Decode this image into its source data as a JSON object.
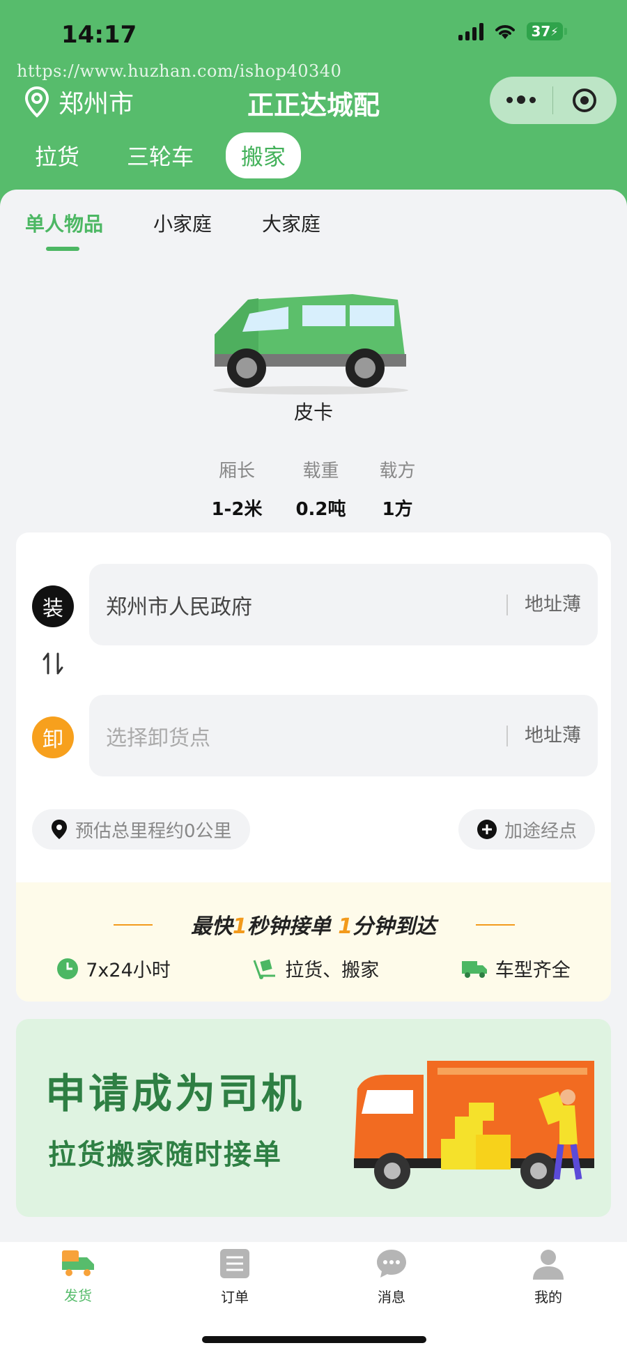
{
  "status": {
    "time": "14:17",
    "battery": "37"
  },
  "watermark": "https://www.huzhan.com/ishop40340",
  "header": {
    "city": "郑州市",
    "title": "正正达城配"
  },
  "top_tabs": [
    {
      "label": "拉货",
      "active": false
    },
    {
      "label": "三轮车",
      "active": false
    },
    {
      "label": "搬家",
      "active": true
    }
  ],
  "sub_tabs": [
    {
      "label": "单人物品",
      "active": true
    },
    {
      "label": "小家庭",
      "active": false
    },
    {
      "label": "大家庭",
      "active": false
    }
  ],
  "vehicle": {
    "name": "皮卡",
    "specs": [
      {
        "label": "厢长",
        "value": "1-2米"
      },
      {
        "label": "载重",
        "value": "0.2吨"
      },
      {
        "label": "载方",
        "value": "1方"
      }
    ]
  },
  "route": {
    "load": {
      "badge": "装",
      "value": "郑州市人民政府",
      "book": "地址薄",
      "color": "#111111"
    },
    "unload": {
      "badge": "卸",
      "placeholder": "选择卸货点",
      "book": "地址薄",
      "color": "#f7a01d"
    },
    "distance": "预估总里程约0公里",
    "add_stop": "加途经点"
  },
  "promo": {
    "title_parts": [
      "最快",
      "1",
      "秒钟接单 ",
      "1",
      "分钟到达"
    ],
    "features": [
      "7x24小时",
      "拉货、搬家",
      "车型齐全"
    ]
  },
  "banner": {
    "line1": "申请成为司机",
    "line2": "拉货搬家随时接单"
  },
  "nav": [
    {
      "label": "发货",
      "icon": "truck-icon",
      "active": true
    },
    {
      "label": "订单",
      "icon": "list-icon",
      "active": false
    },
    {
      "label": "消息",
      "icon": "chat-icon",
      "active": false
    },
    {
      "label": "我的",
      "icon": "user-icon",
      "active": false
    }
  ],
  "colors": {
    "brand": "#57bc6c",
    "accent": "#f29a1c"
  }
}
